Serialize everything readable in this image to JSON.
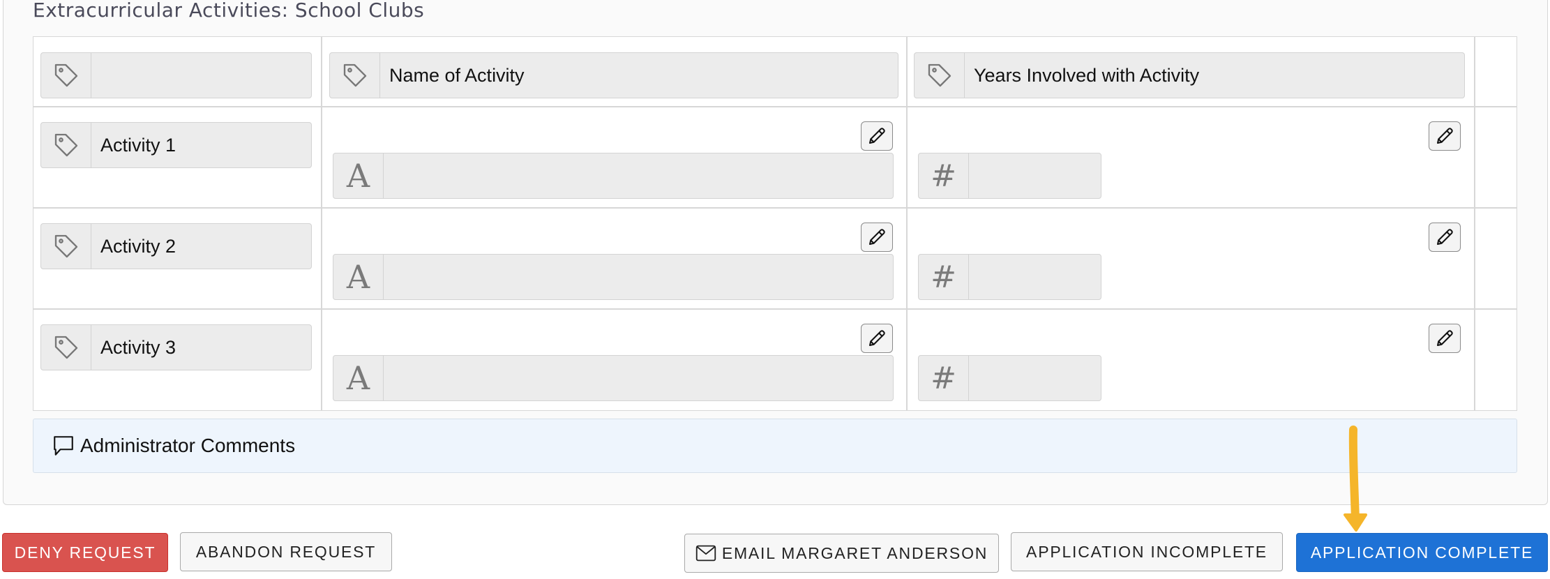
{
  "section": {
    "title": "Extracurricular Activities: School Clubs"
  },
  "table": {
    "header": {
      "corner_label": "",
      "col1_label": "Name of Activity",
      "col2_label": "Years Involved with Activity"
    },
    "rows": [
      {
        "label": "Activity 1",
        "name_value": "",
        "years_value": ""
      },
      {
        "label": "Activity 2",
        "name_value": "",
        "years_value": ""
      },
      {
        "label": "Activity 3",
        "name_value": "",
        "years_value": ""
      }
    ],
    "text_prefix_glyph": "A",
    "number_prefix_glyph": "#"
  },
  "comments": {
    "label": "Administrator Comments",
    "icon": "speech-bubble-icon"
  },
  "actions": {
    "deny": "DENY REQUEST",
    "abandon": "ABANDON REQUEST",
    "email": "EMAIL MARGARET ANDERSON",
    "incomplete": "APPLICATION INCOMPLETE",
    "complete": "APPLICATION COMPLETE"
  },
  "icons": {
    "tag": "tag-icon",
    "edit": "pencil-icon",
    "email": "envelope-icon",
    "annotation": "arrow-down-icon"
  },
  "colors": {
    "deny": "#d9534f",
    "complete": "#1e72d6",
    "comments_bg": "#eef5fd",
    "arrow": "#f5b52a"
  }
}
